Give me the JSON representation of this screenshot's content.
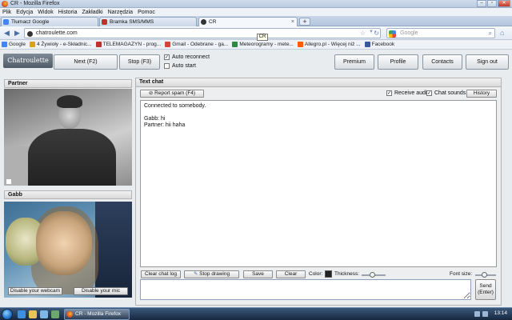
{
  "window": {
    "title": "CR - Mozilla Firefox"
  },
  "menu": [
    "Plik",
    "Edycja",
    "Widok",
    "Historia",
    "Zakładki",
    "Narzędzia",
    "Pomoc"
  ],
  "tabs": [
    {
      "label": "Tłumacz Google",
      "active": false
    },
    {
      "label": "Bramka SMS/MMS",
      "active": false
    },
    {
      "label": "CR",
      "active": true
    }
  ],
  "nav": {
    "url": "chatroulette.com",
    "tooltip": "CR",
    "search_placeholder": "Google"
  },
  "bookmarks": [
    {
      "label": "Google",
      "icon": "google-icon",
      "color": "#4285f4"
    },
    {
      "label": "4 Żywioły - e-Składnic...",
      "icon": "elements-icon",
      "color": "#d9a21b"
    },
    {
      "label": "TELEMAGAZYN - prog...",
      "icon": "telemagazyn-icon",
      "color": "#c0302e"
    },
    {
      "label": "Gmail - Odebrane - ga...",
      "icon": "gmail-icon",
      "color": "#d44638"
    },
    {
      "label": "Meteorogramy - mete...",
      "icon": "icm-icon",
      "color": "#2d8a3e"
    },
    {
      "label": "Allegro.pl - Więcej niż ...",
      "icon": "allegro-icon",
      "color": "#ff5a00"
    },
    {
      "label": "Facebook",
      "icon": "facebook-icon",
      "color": "#3b5998"
    }
  ],
  "site": {
    "logo": "Chatroulette",
    "next_label": "Next (F2)",
    "stop_label": "Stop (F3)",
    "auto_reconnect": {
      "label": "Auto reconnect",
      "checked": true
    },
    "auto_start": {
      "label": "Auto start",
      "checked": false
    },
    "premium_label": "Premium",
    "profile_label": "Profile",
    "contacts_label": "Contacts",
    "signout_label": "Sign out"
  },
  "partner_panel": {
    "title": "Partner"
  },
  "self_panel": {
    "title": "Gabb",
    "disable_webcam": "Disable your webcam",
    "disable_mic": "Disable your mic"
  },
  "chat": {
    "title": "Text chat",
    "report_spam": "Report spam (F4)",
    "receive_audio": {
      "label": "Receive audio",
      "checked": true
    },
    "chat_sounds": {
      "label": "Chat sounds",
      "checked": true
    },
    "history": "History",
    "log": [
      "Connected to somebody.",
      "",
      "Gabb: hi",
      "Partner: hii haha"
    ],
    "clear_chat_log": "Clear chat log",
    "stop_drawing": "Stop drawing",
    "save": "Save",
    "clear": "Clear",
    "color_label": "Color:",
    "thickness_label": "Thickness:",
    "font_size_label": "Font size:",
    "send_label": "Send",
    "send_key": "(Enter)"
  },
  "taskbar": {
    "task_label": "CR - Mozilla Firefox",
    "clock": "13:14"
  }
}
